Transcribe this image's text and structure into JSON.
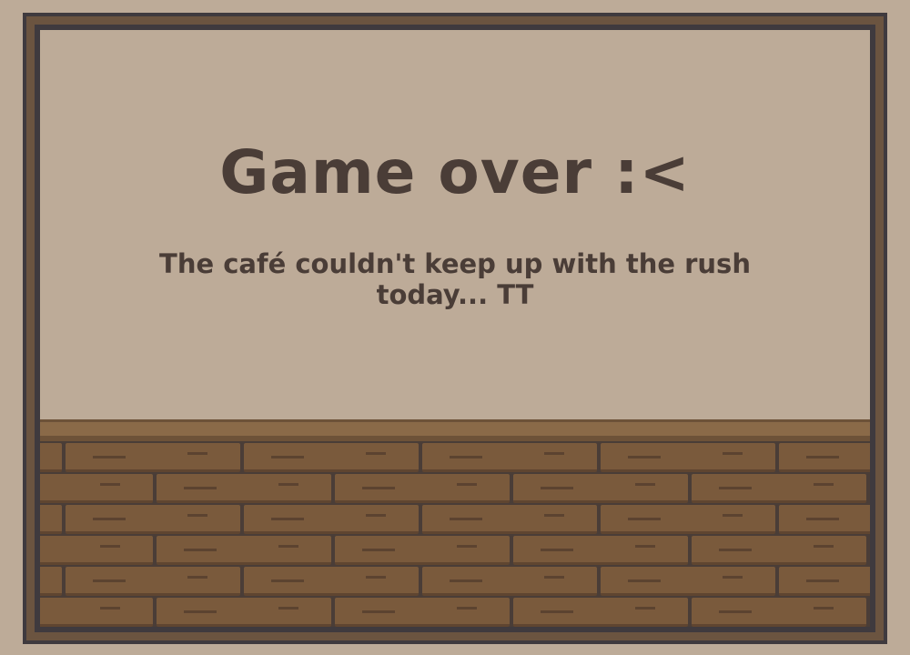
{
  "game_over": {
    "title": "Game over :<",
    "message": "The café couldn't keep up with the rush today... TT"
  },
  "colors": {
    "background": "#bdab98",
    "frame_dark": "#3f3a3e",
    "frame_wood": "#6b5440",
    "wall": "#bdab98",
    "floor_plank": "#7a5a3c",
    "floor_gap": "#4a3d37",
    "text": "#4a3d37"
  }
}
